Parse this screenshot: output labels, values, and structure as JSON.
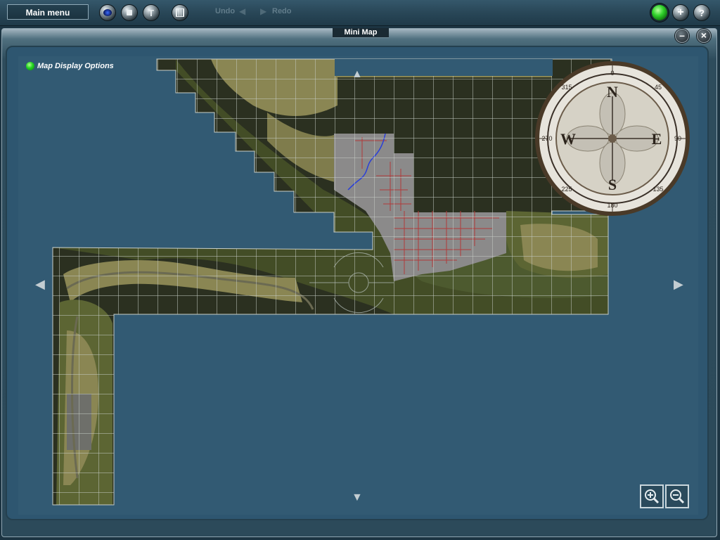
{
  "toolbar": {
    "main_menu_label": "Main menu",
    "undo_label": "Undo",
    "redo_label": "Redo",
    "tools": [
      {
        "icon": "camera-icon"
      },
      {
        "icon": "stop-icon"
      },
      {
        "icon": "tool-icon"
      },
      {
        "icon": "grid-icon"
      }
    ],
    "right_buttons": [
      {
        "icon": "status-light-icon"
      },
      {
        "icon": "add-icon"
      },
      {
        "icon": "help-icon"
      }
    ]
  },
  "window": {
    "title": "Mini Map",
    "minimize_icon": "minimize-icon",
    "close_icon": "close-icon"
  },
  "map": {
    "display_options_label": "Map Display Options",
    "compass": {
      "letters": {
        "n": "N",
        "e": "E",
        "s": "S",
        "w": "W"
      },
      "degrees": {
        "d0": "0",
        "d45": "45",
        "d270": "270",
        "d180": "180",
        "d90": "90",
        "d135": "135",
        "d225": "225",
        "d315": "315"
      }
    },
    "colors": {
      "water": "#325a73",
      "land_dark": "#2b3020",
      "land_olive": "#4d5a2f",
      "land_tan": "#8a8653",
      "urban": "#8b8a8a",
      "roads": "#b23a3a",
      "river": "#2a3fd8",
      "grid": "#c8cfc8"
    }
  }
}
